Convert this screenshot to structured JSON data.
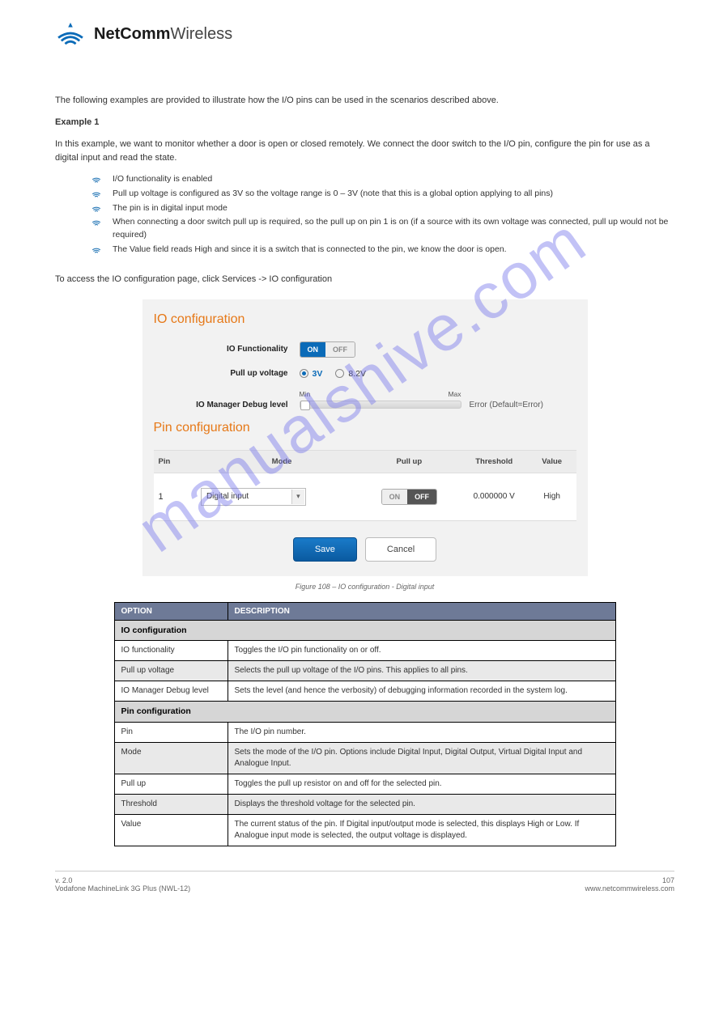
{
  "logo": {
    "bold": "NetComm",
    "light": "Wireless"
  },
  "intro": "The following examples are provided to illustrate how the I/O pins can be used in the scenarios described above.",
  "example_title": "Example 1",
  "example_body": "In this example, we want to monitor whether a door is open or closed remotely. We connect the door switch to the I/O pin, configure the pin for use as a digital input and read the state.",
  "nav": "To access the IO configuration page, click Services -> IO configuration",
  "bullets": [
    "I/O functionality is enabled",
    "Pull up voltage is configured as 3V so the voltage range is 0 – 3V (note that this is a global option applying to all pins)",
    "The pin is in digital input mode",
    "When connecting a door switch pull up is required, so the pull up on pin 1 is on (if a source with its own voltage was connected, pull up would not be required)",
    "The Value field reads High and since it is a switch that is connected to the pin, we know the door is open."
  ],
  "figure": {
    "io_title": "IO configuration",
    "label_func": "IO Functionality",
    "toggle_on": "ON",
    "toggle_off": "OFF",
    "label_pull": "Pull up voltage",
    "radio_3v": "3V",
    "radio_8v": "8.2V",
    "label_dbg": "IO Manager Debug level",
    "min": "Min",
    "max": "Max",
    "dbg_readout": "Error (Default=Error)",
    "pin_title": "Pin configuration",
    "th_pin": "Pin",
    "th_mode": "Mode",
    "th_pull": "Pull up",
    "th_thr": "Threshold",
    "th_val": "Value",
    "row_pin": "1",
    "row_mode": "Digital input",
    "row_thr": "0.000000 V",
    "row_val": "High",
    "btn_save": "Save",
    "btn_cancel": "Cancel"
  },
  "caption": "Figure 108 – IO configuration - Digital input",
  "table": {
    "h_opt": "OPTION",
    "h_desc": "DESCRIPTION",
    "sec1": "IO configuration",
    "r1a": "IO functionality",
    "r1b": "Toggles the I/O pin functionality on or off.",
    "r2a": "Pull up voltage",
    "r2b": "Selects the pull up voltage of the I/O pins. This applies to all pins.",
    "r3a": "IO Manager Debug level",
    "r3b": "Sets the level (and hence the verbosity) of debugging information recorded in the system log.",
    "sec2": "Pin configuration",
    "r4a": "Pin",
    "r4b": "The I/O pin number.",
    "r5a": "Mode",
    "r5b": "Sets the mode of the I/O pin. Options include Digital Input, Digital Output, Virtual Digital Input and Analogue Input.",
    "r6a": "Pull up",
    "r6b": "Toggles the pull up resistor on and off for the selected pin.",
    "r7a": "Threshold",
    "r7b": "Displays the threshold voltage for the selected pin.",
    "r8a": "Value",
    "r8b": "The current status of the pin. If Digital input/output mode is selected, this displays High or Low. If Analogue input mode is selected, the output voltage is displayed."
  },
  "footer": {
    "pn": "107",
    "line1": "Vodafone MachineLink 3G Plus (NWL-12)",
    "left_prefix": "v. 2.0",
    "brand": "www.netcommwireless.com"
  },
  "watermark": "manualshive.com"
}
